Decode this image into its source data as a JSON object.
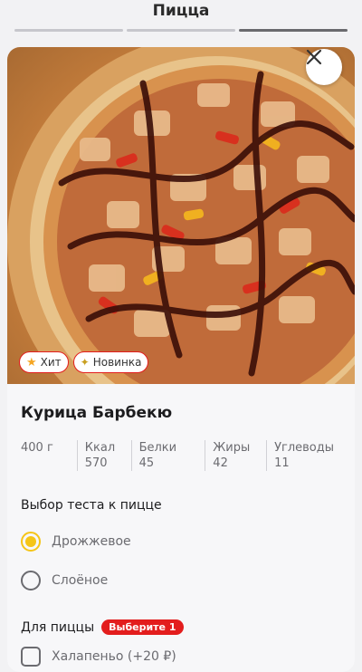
{
  "header": {
    "title": "Пицца",
    "progress_steps": 3,
    "active_step": 3
  },
  "product": {
    "name": "Курица Барбекю",
    "badges": [
      {
        "icon": "star-icon",
        "label": "Хит"
      },
      {
        "icon": "party-popper-icon",
        "label": "Новинка"
      }
    ],
    "nutrition": {
      "weight": "400 г",
      "kcal_label": "Ккал",
      "kcal_value": "570",
      "protein_label": "Белки",
      "protein_value": "45",
      "fat_label": "Жиры",
      "fat_value": "42",
      "carbs_label": "Углеводы",
      "carbs_value": "11"
    }
  },
  "dough": {
    "title": "Выбор теста к пицце",
    "options": [
      {
        "label": "Дрожжевое",
        "selected": true
      },
      {
        "label": "Слоёное",
        "selected": false
      }
    ]
  },
  "addons": {
    "title": "Для пиццы",
    "required_badge": "Выберите 1",
    "items": [
      {
        "label": "Халапеньо (+20 ₽)",
        "checked": false
      }
    ]
  },
  "colors": {
    "accent_red": "#e31d1d",
    "accent_yellow": "#f5c518"
  }
}
